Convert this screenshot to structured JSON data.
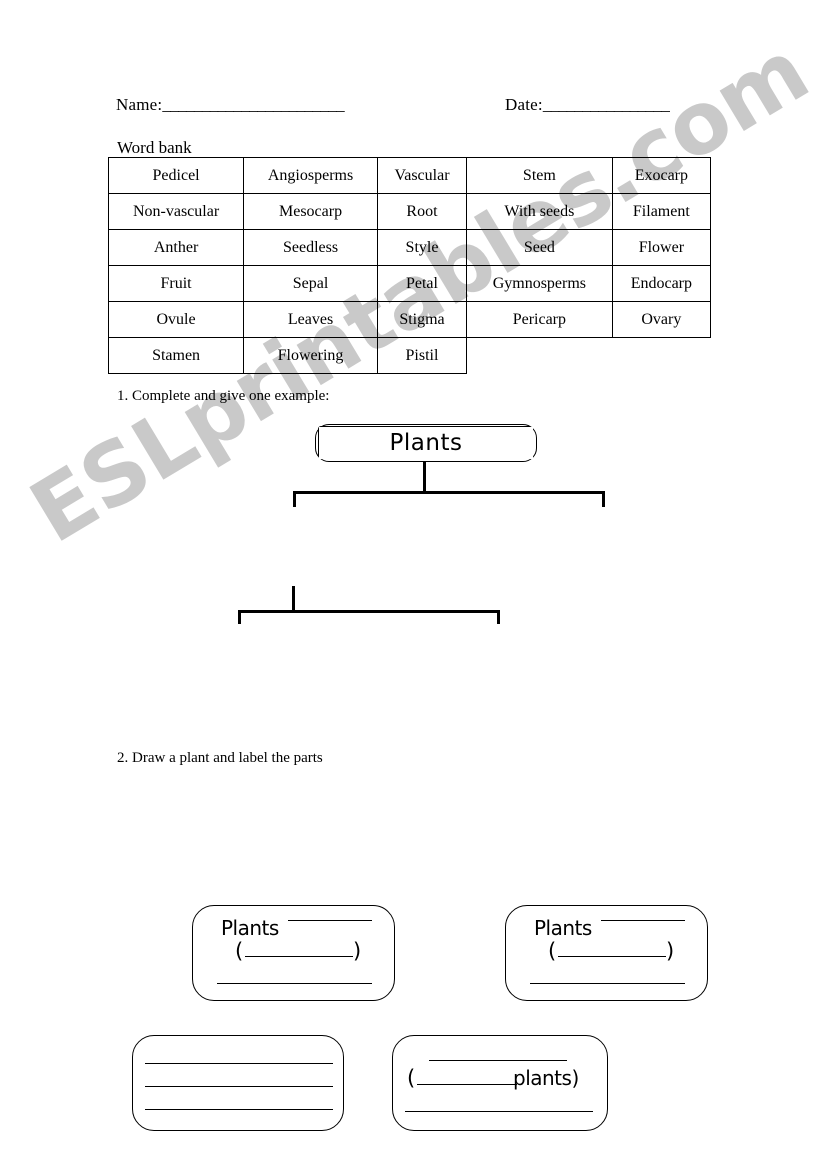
{
  "page": {
    "watermark": "ESLprintables.com",
    "watermark_color": "#c9c9c9"
  },
  "header": {
    "name_label": "Name:",
    "name_blank": "_______________________",
    "date_label": "Date:",
    "date_blank": "________________"
  },
  "wordbank": {
    "title": "Word bank",
    "rows": [
      [
        "Pedicel",
        "Angiosperms",
        "Vascular",
        "Stem",
        "Exocarp"
      ],
      [
        "Non-vascular",
        "Mesocarp",
        "Root",
        "With seeds",
        "Filament"
      ],
      [
        "Anther",
        "Seedless",
        "Style",
        "Seed",
        "Flower"
      ],
      [
        "Fruit",
        "Sepal",
        "Petal",
        "Gymnosperms",
        "Endocarp"
      ],
      [
        "Ovule",
        "Leaves",
        "Stigma",
        "Pericarp",
        "Ovary"
      ],
      [
        "Stamen",
        "Flowering",
        "Pistil",
        "",
        ""
      ]
    ]
  },
  "questions": {
    "q1": "1. Complete and give one example:",
    "q2": "2. Draw a plant and label the parts"
  },
  "diagram": {
    "root": {
      "label": "Plants"
    },
    "level2_left": {
      "word": "Plants",
      "paren_open": "(",
      "paren_close": ")"
    },
    "level2_right": {
      "word": "Plants",
      "paren_open": "(",
      "paren_close": ")"
    },
    "level3_left": {},
    "level3_right": {
      "paren_open": "(",
      "word": "plants)"
    }
  }
}
